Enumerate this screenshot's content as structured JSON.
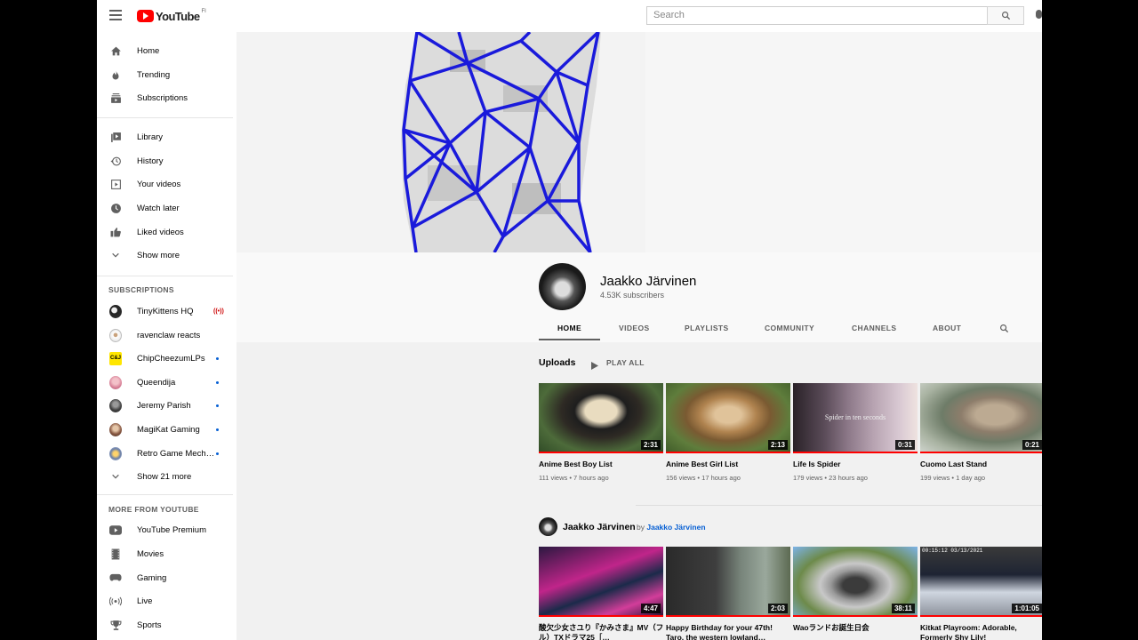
{
  "header": {
    "logo_text": "YouTube",
    "logo_region": "FI",
    "search_placeholder": "Search"
  },
  "sidebar": {
    "main": [
      {
        "label": "Home",
        "icon": "home-icon"
      },
      {
        "label": "Trending",
        "icon": "trending-icon"
      },
      {
        "label": "Subscriptions",
        "icon": "subscriptions-icon"
      }
    ],
    "library": [
      {
        "label": "Library",
        "icon": "library-icon"
      },
      {
        "label": "History",
        "icon": "history-icon"
      },
      {
        "label": "Your videos",
        "icon": "your-videos-icon"
      },
      {
        "label": "Watch later",
        "icon": "watch-later-icon"
      },
      {
        "label": "Liked videos",
        "icon": "liked-videos-icon"
      },
      {
        "label": "Show more",
        "icon": "chevron-down-icon"
      }
    ],
    "subscriptions_heading": "SUBSCRIPTIONS",
    "subscriptions": [
      {
        "label": "TinyKittens HQ",
        "status": "live"
      },
      {
        "label": "ravenclaw reacts",
        "status": ""
      },
      {
        "label": "ChipCheezumLPs",
        "status": "new"
      },
      {
        "label": "Queendija",
        "status": "new"
      },
      {
        "label": "Jeremy Parish",
        "status": "new"
      },
      {
        "label": "MagiKat Gaming",
        "status": "new"
      },
      {
        "label": "Retro Game Mech…",
        "status": "new"
      }
    ],
    "show_more_subs": "Show 21 more",
    "more_heading": "MORE FROM YOUTUBE",
    "more": [
      {
        "label": "YouTube Premium",
        "icon": "youtube-premium-icon"
      },
      {
        "label": "Movies",
        "icon": "movies-icon"
      },
      {
        "label": "Gaming",
        "icon": "gaming-icon"
      },
      {
        "label": "Live",
        "icon": "live-icon"
      },
      {
        "label": "Sports",
        "icon": "sports-icon"
      }
    ]
  },
  "channel": {
    "name": "Jaakko Järvinen",
    "subscribers": "4.53K subscribers",
    "tabs": [
      "HOME",
      "VIDEOS",
      "PLAYLISTS",
      "COMMUNITY",
      "CHANNELS",
      "ABOUT"
    ]
  },
  "uploads": {
    "title": "Uploads",
    "play_all": "PLAY ALL",
    "videos": [
      {
        "title": "Anime Best Boy List",
        "meta": "111 views • 7 hours ago",
        "duration": "2:31"
      },
      {
        "title": "Anime Best Girl List",
        "meta": "156 views • 17 hours ago",
        "duration": "2:13"
      },
      {
        "title": "Life Is Spider",
        "meta": "179 views • 23 hours ago",
        "duration": "0:31",
        "overlay": "Spider in ten seconds"
      },
      {
        "title": "Cuomo Last Stand",
        "meta": "199 views • 1 day ago",
        "duration": "0:21"
      }
    ]
  },
  "playlist": {
    "title": "Jaakko Järvinen",
    "by_prefix": "by",
    "by_channel": "Jaakko Järvinen",
    "videos": [
      {
        "title": "酸欠少女さユり『かみさま』MV（フル）TXドラマ25［…",
        "duration": "4:47"
      },
      {
        "title": "Happy Birthday for your 47th! Taro, the western lowland…",
        "duration": "2:03"
      },
      {
        "title": "Waoランドお誕生日会",
        "duration": "38:11"
      },
      {
        "title": "Kitkat Playroom: Adorable, Formerly Shy Lily!",
        "duration": "1:01:05",
        "overlay": "00:15:12 03/13/2021"
      }
    ]
  }
}
